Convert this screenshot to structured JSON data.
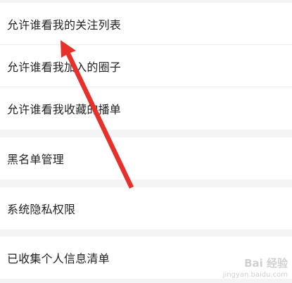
{
  "settings": {
    "group1": [
      {
        "label": "允许谁看我的关注列表"
      },
      {
        "label": "允许谁看我加入的圈子"
      },
      {
        "label": "允许谁看我收藏的播单"
      }
    ],
    "group2": [
      {
        "label": "黑名单管理"
      }
    ],
    "group3": [
      {
        "label": "系统隐私权限"
      }
    ],
    "group4": [
      {
        "label": "已收集个人信息清单"
      }
    ]
  },
  "annotation": {
    "arrow_color": "#e8302a"
  },
  "watermark": {
    "logo_text": "Bai  经验",
    "url": "jingyan.baidu.com"
  }
}
